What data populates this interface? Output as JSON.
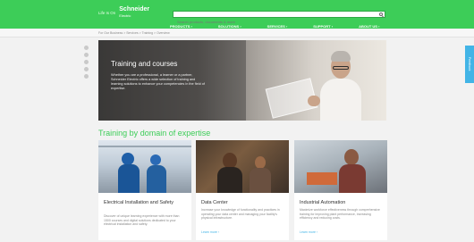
{
  "header": {
    "tagline": "Life Is On",
    "logo_name": "Schneider",
    "logo_sub": "Electric",
    "search_placeholder": "Search products, documents & more",
    "accent_color": "#3dcd58",
    "nav": [
      {
        "label": "PRODUCTS ›"
      },
      {
        "label": "SOLUTIONS ›"
      },
      {
        "label": "SERVICES ›"
      },
      {
        "label": "SUPPORT ›"
      },
      {
        "label": "ABOUT US ›"
      }
    ]
  },
  "breadcrumb": "For Our Business > Services > Training > Overview",
  "share_icons": [
    "facebook-icon",
    "twitter-icon",
    "linkedin-icon",
    "email-icon",
    "print-icon"
  ],
  "feedback_label": "Feedback",
  "hero": {
    "title": "Training and courses",
    "text": "Whether you are a professional, a learner or a partner, Schneider Electric offers a wide selection of training and learning solutions to enhance your competencies in the field of expertise."
  },
  "section_title": "Training by domain of expertise",
  "cards": [
    {
      "title": "Electrical Installation and Safety",
      "desc": "Discover of unique learning experience with more than 1500 courses and digital solutions dedicated to your electrical installation and safety.",
      "link": "Learn more ›"
    },
    {
      "title": "Data Center",
      "desc": "Increase your knowledge of functionality and practices in operating your data center and managing your facility's physical infrastructure.",
      "link": "Learn more ›"
    },
    {
      "title": "Industrial Automation",
      "desc": "Maximize workforce effectiveness through comprehensive training for improving plant performance, increasing efficiency and reducing costs.",
      "link": "Learn more ›"
    }
  ]
}
